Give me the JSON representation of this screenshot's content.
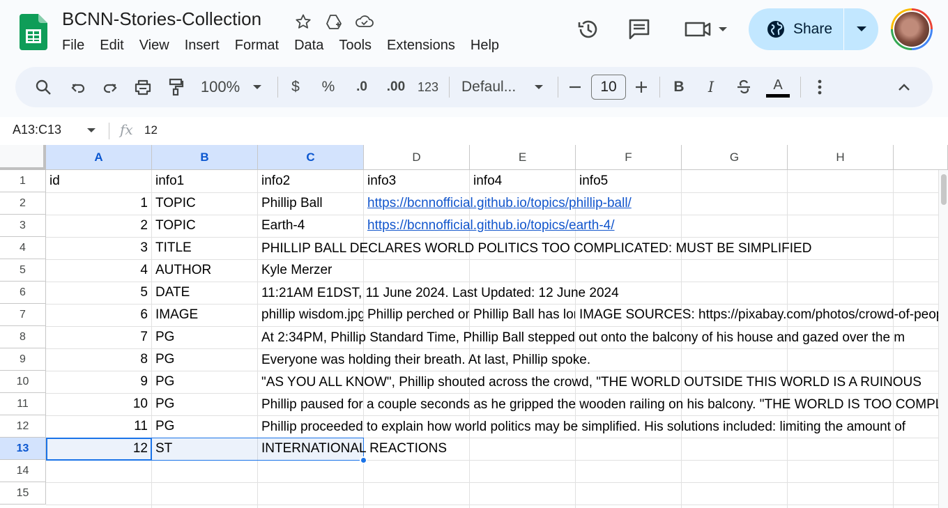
{
  "doc": {
    "title": "BCNN-Stories-Collection",
    "menu": [
      "File",
      "Edit",
      "View",
      "Insert",
      "Format",
      "Data",
      "Tools",
      "Extensions",
      "Help"
    ],
    "share_label": "Share"
  },
  "toolbar": {
    "zoom": "100%",
    "currency": "$",
    "percent": "%",
    "decrease_decimal": ".0",
    "increase_decimal": ".00",
    "more_formats": "123",
    "font": "Defaul...",
    "font_size": "10",
    "bold": "B",
    "italic": "I",
    "text_color_letter": "A",
    "text_color": "#000000"
  },
  "formula_bar": {
    "name_box": "A13:C13",
    "fx": "fx",
    "value": "12"
  },
  "grid": {
    "columns": [
      "A",
      "B",
      "C",
      "D",
      "E",
      "F",
      "G",
      "H"
    ],
    "selected_columns": [
      "A",
      "B",
      "C"
    ],
    "rows": [
      "1",
      "2",
      "3",
      "4",
      "5",
      "6",
      "7",
      "8",
      "9",
      "10",
      "11",
      "12",
      "13",
      "14",
      "15"
    ],
    "selected_row": "13",
    "cells": {
      "r1": {
        "a": "id",
        "b": "info1",
        "c": "info2",
        "d": "info3",
        "e": "info4",
        "f": "info5"
      },
      "r2": {
        "a": "1",
        "b": "TOPIC",
        "c": "Phillip Ball",
        "d": "https://bcnnofficial.github.io/topics/phillip-ball/"
      },
      "r3": {
        "a": "2",
        "b": "TOPIC",
        "c": "Earth-4",
        "d": "https://bcnnofficial.github.io/topics/earth-4/"
      },
      "r4": {
        "a": "3",
        "b": "TITLE",
        "c": "PHILLIP BALL DECLARES WORLD POLITICS TOO COMPLICATED: MUST BE SIMPLIFIED"
      },
      "r5": {
        "a": "4",
        "b": "AUTHOR",
        "c": "Kyle Merzer"
      },
      "r6": {
        "a": "5",
        "b": "DATE",
        "c": "11:21AM E1DST, 11 June 2024. Last Updated: 12 June 2024"
      },
      "r7": {
        "a": "6",
        "b": "IMAGE",
        "c": "phillip wisdom.jpg",
        "d": "Phillip perched on his balcony",
        "e": "Phillip Ball has long",
        "f": "IMAGE SOURCES: https://pixabay.com/photos/crowd-of-people"
      },
      "r8": {
        "a": "7",
        "b": "PG",
        "c": "At 2:34PM, Phillip Standard Time, Phillip Ball stepped out onto the balcony of his house and gazed over the m"
      },
      "r9": {
        "a": "8",
        "b": "PG",
        "c": "Everyone was holding their breath. At last, Phillip spoke."
      },
      "r10": {
        "a": "9",
        "b": "PG",
        "c": "\"AS YOU ALL KNOW\", Phillip shouted across the crowd, \"THE WORLD OUTSIDE THIS WORLD IS A RUINOUS"
      },
      "r11": {
        "a": "10",
        "b": "PG",
        "c": "Phillip paused for a couple seconds as he gripped the wooden railing on his balcony. \"THE WORLD IS TOO COMPLICATED"
      },
      "r12": {
        "a": "11",
        "b": "PG",
        "c": "Phillip proceeded to explain how world politics may be simplified. His solutions included: limiting the amount of"
      },
      "r13": {
        "a": "12",
        "b": "ST",
        "c": "INTERNATIONAL REACTIONS"
      }
    }
  }
}
